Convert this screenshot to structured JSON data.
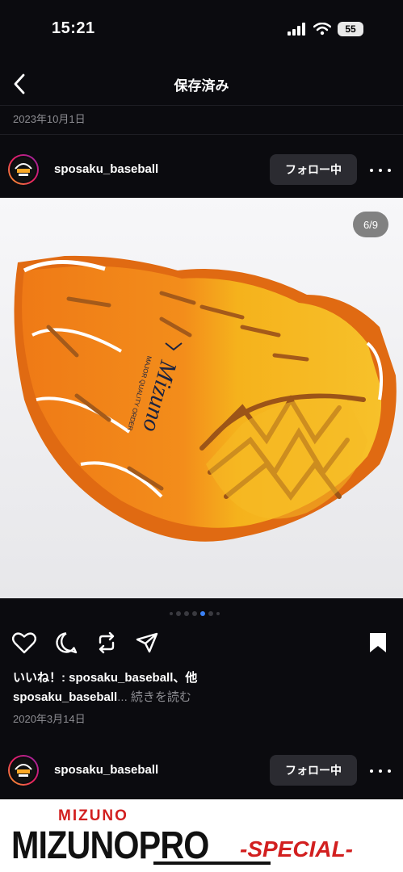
{
  "status_bar": {
    "time": "15:21",
    "battery": "55"
  },
  "header": {
    "title": "保存済み"
  },
  "top_date": "2023年10月1日",
  "post": {
    "username": "sposaku_baseball",
    "follow_label": "フォロー中",
    "image_counter": "6/9",
    "glove_brand": "Mizuno",
    "glove_line": "MAJOR QUALITY ORDER",
    "likes": "いいね！: sposaku_baseball、他",
    "caption_user": "sposaku_baseball",
    "caption_more": "... 続きを読む",
    "date": "2020年3月14日",
    "carousel": {
      "total": 7,
      "active": 4
    }
  },
  "next_post": {
    "username": "sposaku_baseball",
    "follow_label": "フォロー中",
    "brand_small": "MIZUNO",
    "brand_large": "MIZUNOPRO",
    "brand_special": "-SPECIAL-"
  },
  "icons": [
    "back-chevron-icon",
    "signal-icon",
    "wifi-icon",
    "battery-icon",
    "more-icon",
    "heart-icon",
    "comment-icon",
    "repost-icon",
    "share-icon",
    "bookmark-icon"
  ],
  "colors": {
    "background": "#0b0b0f",
    "follow_button": "#2b2b31",
    "active_dot": "#3b82f6",
    "muted_text": "#8e8e93",
    "brand_red": "#d21f1f"
  }
}
